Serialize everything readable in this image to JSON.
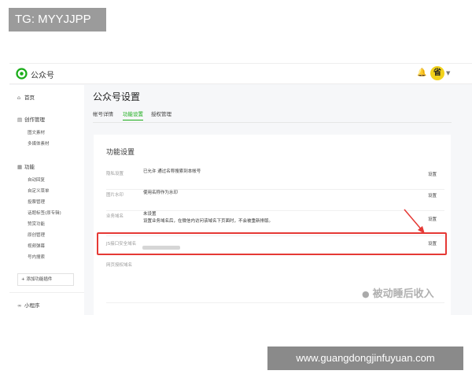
{
  "overlay_tag": "TG: MYYJJPP",
  "footer_url": "www.guangdongjinfuyuan.com",
  "watermark": "被动睡后收入",
  "app": {
    "name": "公众号",
    "avatar_char": "省"
  },
  "sidebar": {
    "home": "首页",
    "create_group": "创作管理",
    "create_items": [
      "图文素材",
      "多媒体素材"
    ],
    "function_group": "功能",
    "function_items": [
      "自动回复",
      "自定义菜单",
      "投票管理",
      "话题标签(原专辑)",
      "赞赏功能",
      "原创管理",
      "视频弹幕",
      "号内搜索"
    ],
    "add_plugin": "添加功能插件",
    "mini_program": "小程序"
  },
  "main": {
    "title": "公众号设置",
    "tabs": [
      "帐号详情",
      "功能设置",
      "授权管理"
    ],
    "active_tab_index": 1,
    "card_title": "功能设置",
    "rows": [
      {
        "label": "隐私设置",
        "value": "已允许 通过名称搜索到本帐号",
        "action": "设置"
      },
      {
        "label": "图片水印",
        "value": "使用名称作为水印",
        "action": "设置"
      },
      {
        "label": "业务域名",
        "value": "未设置",
        "value2": "设置业务域名后，在微信内访问该域名下页面时，不会被重新排版。",
        "action": "设置"
      },
      {
        "label": "JS接口安全域名",
        "value": "",
        "action": "设置"
      },
      {
        "label": "网页授权域名",
        "value": "",
        "action": ""
      }
    ]
  },
  "colors": {
    "accent_green": "#1aad19",
    "highlight_red": "#e53935",
    "avatar_yellow": "#f2d21b"
  }
}
